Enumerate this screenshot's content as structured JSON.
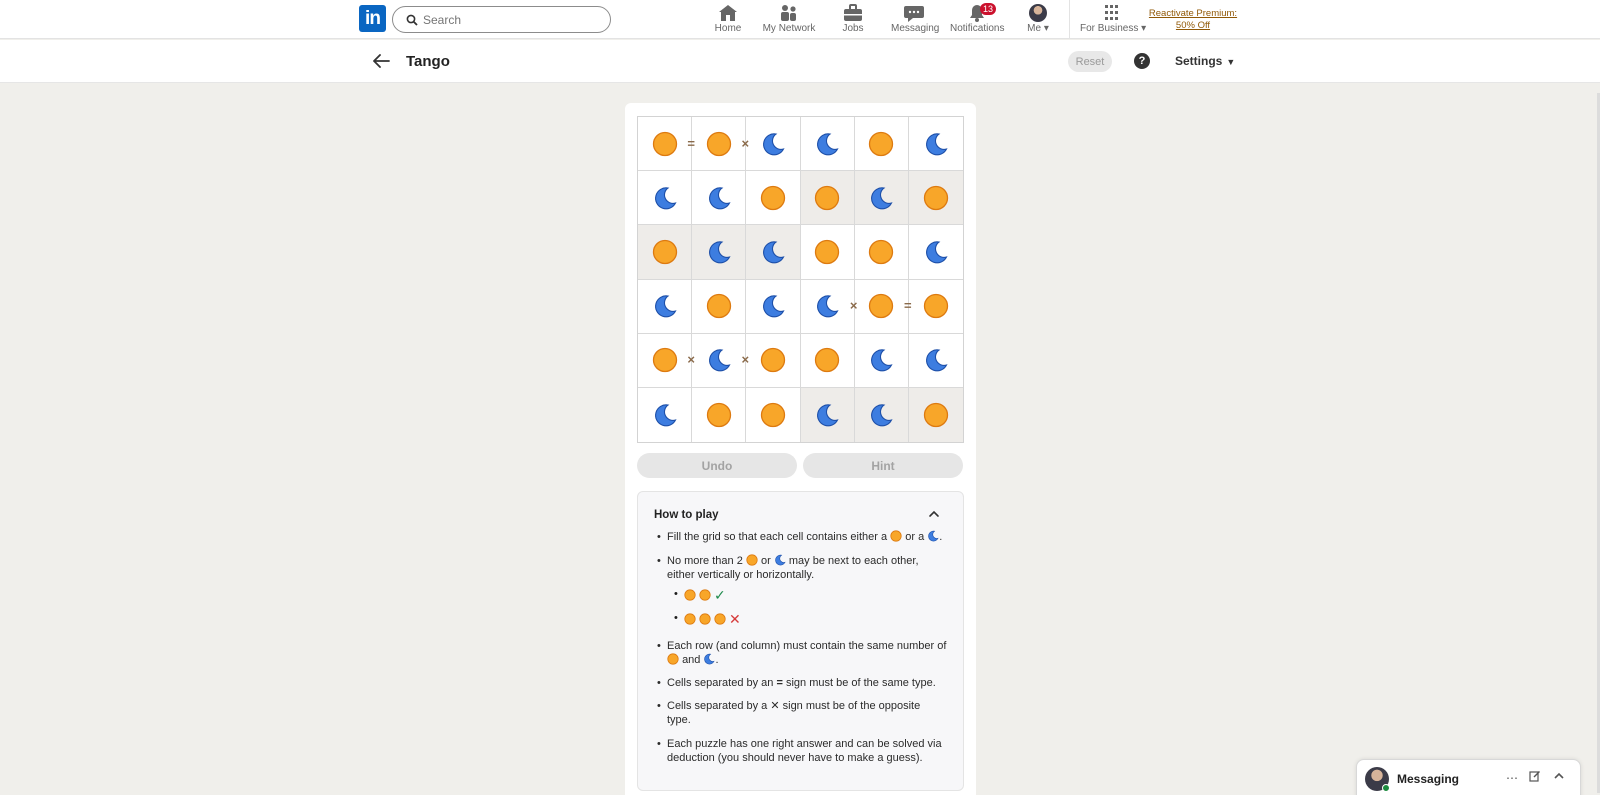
{
  "nav": {
    "logo": "in",
    "search_placeholder": "Search",
    "items": [
      {
        "label": "Home",
        "icon": "home-icon"
      },
      {
        "label": "My Network",
        "icon": "network-icon"
      },
      {
        "label": "Jobs",
        "icon": "briefcase-icon"
      },
      {
        "label": "Messaging",
        "icon": "messaging-icon"
      },
      {
        "label": "Notifications",
        "icon": "bell-icon",
        "badge": "13"
      },
      {
        "label": "Me",
        "icon": "avatar"
      },
      {
        "label": "For Business",
        "icon": "grid-icon"
      }
    ],
    "premium_line1": "Reactivate Premium:",
    "premium_line2": "50% Off"
  },
  "header": {
    "title": "Tango",
    "reset_label": "Reset",
    "help_label": "?",
    "settings_label": "Settings"
  },
  "game": {
    "grid": [
      [
        "sun",
        "sun",
        "moon",
        "moon",
        "sun",
        "moon"
      ],
      [
        "moon",
        "moon",
        "sun",
        "sun",
        "moon",
        "sun"
      ],
      [
        "sun",
        "moon",
        "moon",
        "sun",
        "sun",
        "moon"
      ],
      [
        "moon",
        "sun",
        "moon",
        "moon",
        "sun",
        "sun"
      ],
      [
        "sun",
        "moon",
        "sun",
        "sun",
        "moon",
        "moon"
      ],
      [
        "moon",
        "sun",
        "sun",
        "moon",
        "moon",
        "sun"
      ]
    ],
    "prefilled": [
      [
        1,
        1,
        1,
        1,
        1,
        1
      ],
      [
        1,
        1,
        1,
        0,
        0,
        0
      ],
      [
        0,
        0,
        0,
        1,
        1,
        1
      ],
      [
        1,
        1,
        1,
        1,
        1,
        1
      ],
      [
        1,
        1,
        1,
        1,
        1,
        1
      ],
      [
        1,
        1,
        1,
        0,
        0,
        0
      ]
    ],
    "constraints": [
      {
        "row": 0,
        "col": 0,
        "dir": "right",
        "type": "="
      },
      {
        "row": 0,
        "col": 1,
        "dir": "right",
        "type": "×"
      },
      {
        "row": 3,
        "col": 3,
        "dir": "right",
        "type": "×"
      },
      {
        "row": 3,
        "col": 4,
        "dir": "right",
        "type": "="
      },
      {
        "row": 4,
        "col": 0,
        "dir": "right",
        "type": "×"
      },
      {
        "row": 4,
        "col": 1,
        "dir": "right",
        "type": "×"
      }
    ],
    "undo_label": "Undo",
    "hint_label": "Hint"
  },
  "howto": {
    "title": "How to play",
    "r1_a": "Fill the grid so that each cell contains either a",
    "r1_b": "or a",
    "r1_c": ".",
    "r2_a": "No more than 2",
    "r2_b": "or",
    "r2_c": "may be next to each other,",
    "r2_d": "either vertically or horizontally.",
    "r3_a": "Each row (and column) must contain the same number of",
    "r3_b": "and",
    "r3_c": ".",
    "r4_a": "Cells separated by an",
    "r4_sym": "=",
    "r4_b": "sign must be of the same type.",
    "r5_a": "Cells separated by a",
    "r5_sym": "✕",
    "r5_b": "sign must be of the opposite",
    "r5_c": "type.",
    "r6_a": "Each puzzle has one right answer and can be solved via",
    "r6_b": "deduction (you should never have to make a guess)."
  },
  "messaging": {
    "title": "Messaging"
  },
  "colors": {
    "sun": "#f8a629",
    "moon": "#3d7de0",
    "brand": "#0a66c2"
  }
}
